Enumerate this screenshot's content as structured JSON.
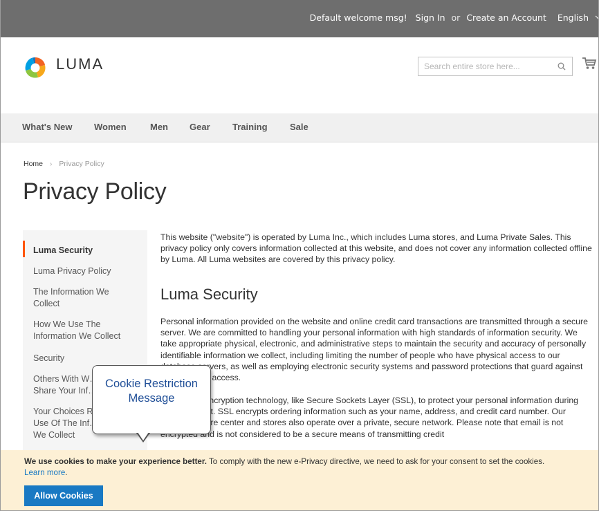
{
  "top_bar": {
    "welcome": "Default welcome msg!",
    "sign_in": "Sign In",
    "or": "or",
    "create_account": "Create an Account",
    "language": "English"
  },
  "header": {
    "logo_text": "LUMA",
    "search_placeholder": "Search entire store here...",
    "search_icon": "search-icon",
    "cart_icon": "cart-icon"
  },
  "nav": {
    "items": [
      "What's New",
      "Women",
      "Men",
      "Gear",
      "Training",
      "Sale"
    ]
  },
  "breadcrumb": {
    "home": "Home",
    "current": "Privacy Policy"
  },
  "page_title": "Privacy Policy",
  "sidebar": {
    "items": [
      "Luma Security",
      "Luma Privacy Policy",
      "The Information We Collect",
      "How We Use The Information We Collect",
      "Security",
      "Others With W… Share Your Inf…",
      "Your Choices R… Use Of The Inf… We Collect"
    ]
  },
  "content": {
    "intro": "This website (\"website\") is operated by Luma Inc., which includes Luma stores, and Luma Private Sales. This privacy policy only covers information collected at this website, and does not cover any information collected offline by Luma. All Luma websites are covered by this privacy policy.",
    "section_title": "Luma Security",
    "para2": "Personal information provided on the website and online credit card transactions are transmitted through a secure server. We are committed to handling your personal information with high standards of information security. We take appropriate physical, electronic, and administrative steps to maintain the security and accuracy of personally identifiable information we collect, including limiting the number of people who have physical access to our database servers, as well as employing electronic security systems and password protections that guard against unauthorized access.",
    "para3": "Luma uses encryption technology, like Secure Sockets Layer (SSL), to protect your personal information during data transport. SSL encrypts ordering information such as your name, address, and credit card number. Our Customer Care center and stores also operate over a private, secure network. Please note that email is not encrypted and is not considered to be a secure means of transmitting credit"
  },
  "callout": {
    "text": "Cookie Restriction Message"
  },
  "cookie_notice": {
    "bold": "We use cookies to make your experience better.",
    "text": " To comply with the new e-Privacy directive, we need to ask for your consent to set the cookies.",
    "learn_more": "Learn more",
    "period": ".",
    "button": "Allow Cookies"
  },
  "colors": {
    "top_bar": "#6e6e6e",
    "accent": "#ff5501",
    "button": "#1979c3",
    "cookie_bg": "#fdf0d5"
  }
}
